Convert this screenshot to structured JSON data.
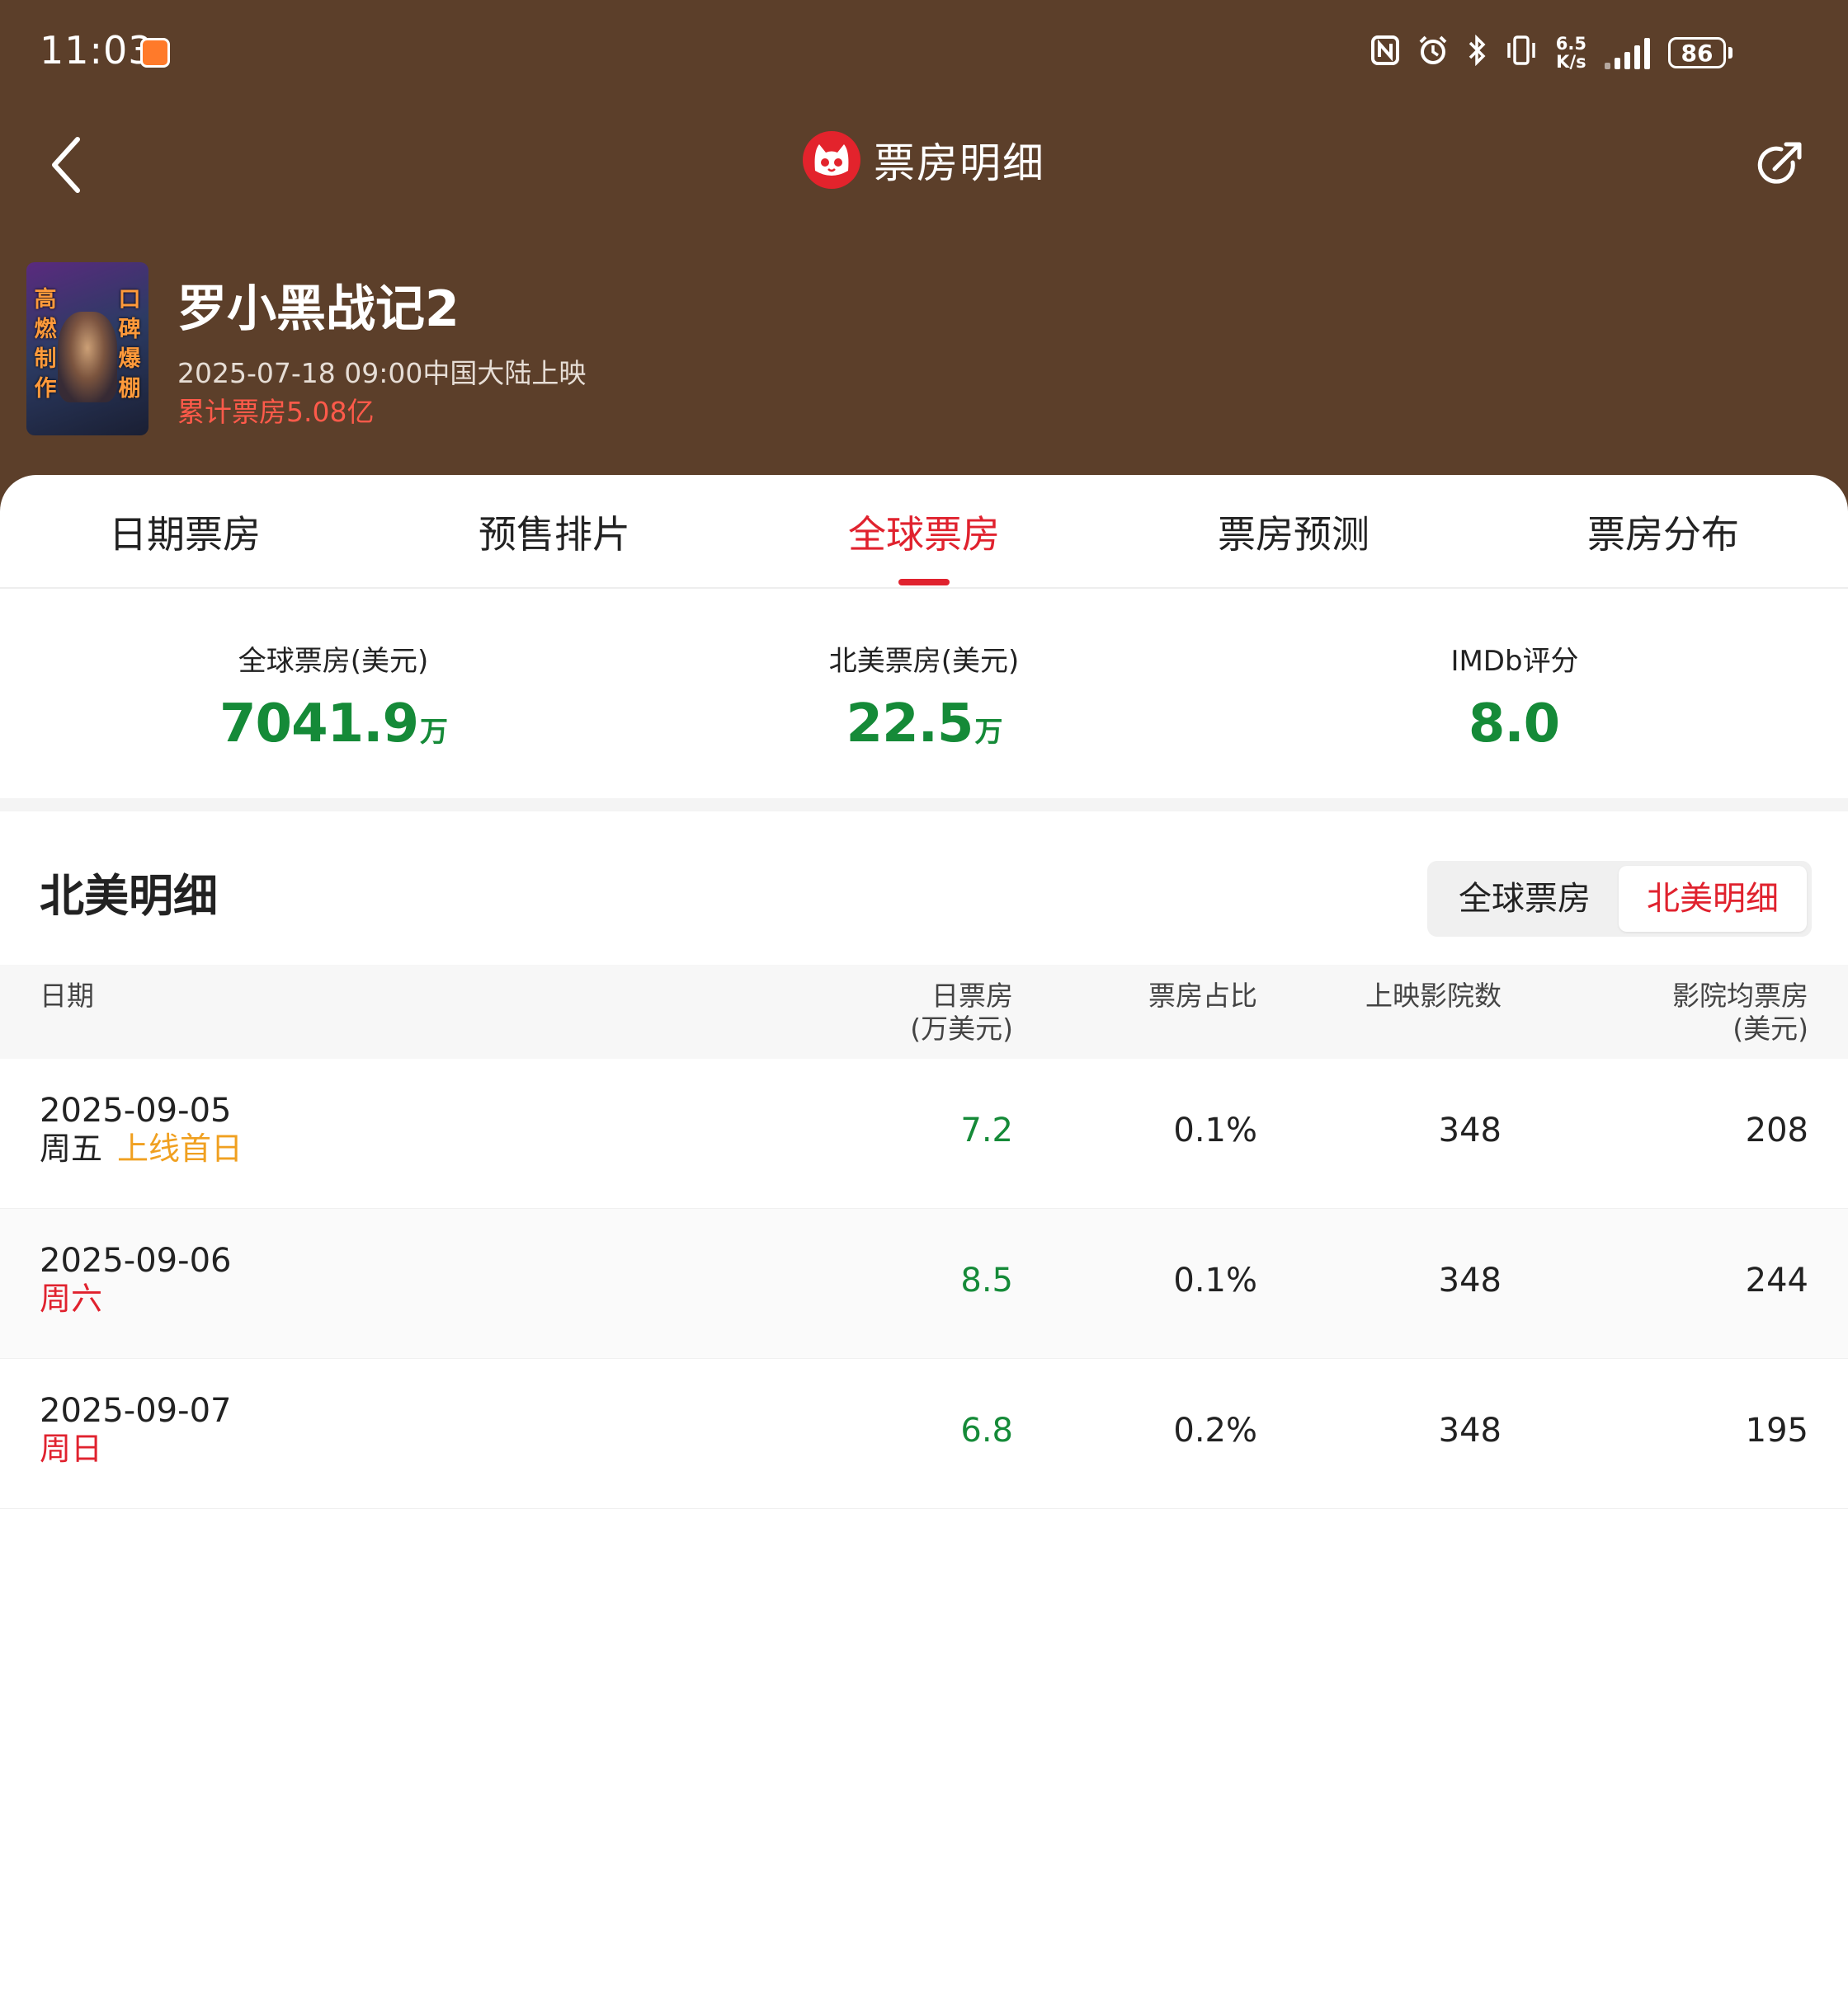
{
  "status_bar": {
    "time": "11:03",
    "net_speed_top": "6.5",
    "net_speed_bottom": "K/s",
    "battery": "86"
  },
  "nav": {
    "title": "票房明细"
  },
  "movie": {
    "title": "罗小黑战记2",
    "release": "2025-07-18 09:00中国大陆上映",
    "total_box_office": "累计票房5.08亿",
    "poster_tag_left": "高燃制作",
    "poster_tag_right": "口碑爆棚"
  },
  "tabs": [
    "日期票房",
    "预售排片",
    "全球票房",
    "票房预测",
    "票房分布"
  ],
  "active_tab": "全球票房",
  "stats": [
    {
      "label": "全球票房(美元)",
      "value": "7041.9",
      "unit": "万"
    },
    {
      "label": "北美票房(美元)",
      "value": "22.5",
      "unit": "万"
    },
    {
      "label": "IMDb评分",
      "value": "8.0",
      "unit": ""
    }
  ],
  "section": {
    "title": "北美明细",
    "toggle": [
      "全球票房",
      "北美明细"
    ],
    "toggle_selected": "北美明细"
  },
  "table": {
    "headers": {
      "date": "日期",
      "daily_line1": "日票房",
      "daily_line2": "(万美元)",
      "share": "票房占比",
      "cinemas": "上映影院数",
      "avg_line1": "影院均票房",
      "avg_line2": "(美元)"
    },
    "rows": [
      {
        "date": "2025-09-05",
        "weekday": "周五",
        "tag": "上线首日",
        "daily": "7.2",
        "share": "0.1%",
        "cinemas": "348",
        "avg": "208"
      },
      {
        "date": "2025-09-06",
        "weekday": "周六",
        "tag": "",
        "daily": "8.5",
        "share": "0.1%",
        "cinemas": "348",
        "avg": "244"
      },
      {
        "date": "2025-09-07",
        "weekday": "周日",
        "tag": "",
        "daily": "6.8",
        "share": "0.2%",
        "cinemas": "348",
        "avg": "195"
      }
    ]
  },
  "colors": {
    "header_bg": "#5c3f2a",
    "accent_red": "#e0222e",
    "value_green": "#158a38",
    "tag_orange": "#f0a020"
  },
  "icons": [
    "back-arrow-icon",
    "cat-logo-icon",
    "share-icon",
    "nfc-icon",
    "alarm-icon",
    "bluetooth-icon",
    "vibrate-icon",
    "signal-icon",
    "battery-icon"
  ]
}
